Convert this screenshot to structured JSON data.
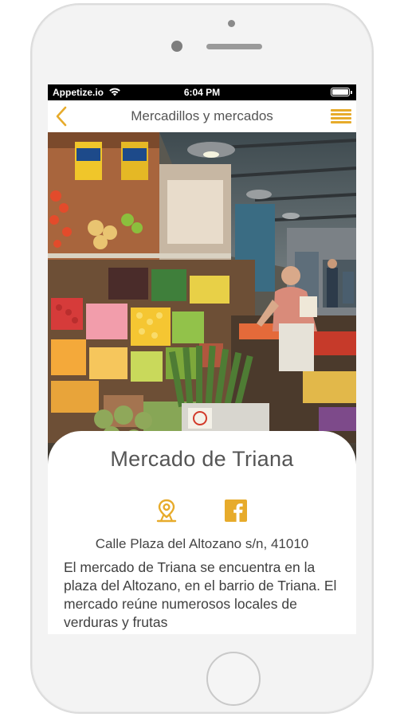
{
  "status_bar": {
    "carrier": "Appetize.io",
    "time": "6:04 PM"
  },
  "nav": {
    "title": "Mercadillos y mercados",
    "back_icon": "chevron-left-icon",
    "menu_icon": "hamburger-menu-icon"
  },
  "place": {
    "name": "Mercado de Triana",
    "address": "Calle Plaza del Altozano s/n, 41010",
    "description": "El mercado de Triana se encuentra en la plaza del Altozano, en el barrio de Triana.  El mercado reúne numerosos locales de verduras y frutas",
    "actions": {
      "location_icon": "location-pin-icon",
      "social_icon": "facebook-icon"
    }
  },
  "colors": {
    "accent": "#e7ab2b",
    "status_bar": "#000000",
    "title_text": "#555555"
  },
  "hero_image": {
    "subject": "market stalls with fruits, vegetables and a vendor"
  }
}
